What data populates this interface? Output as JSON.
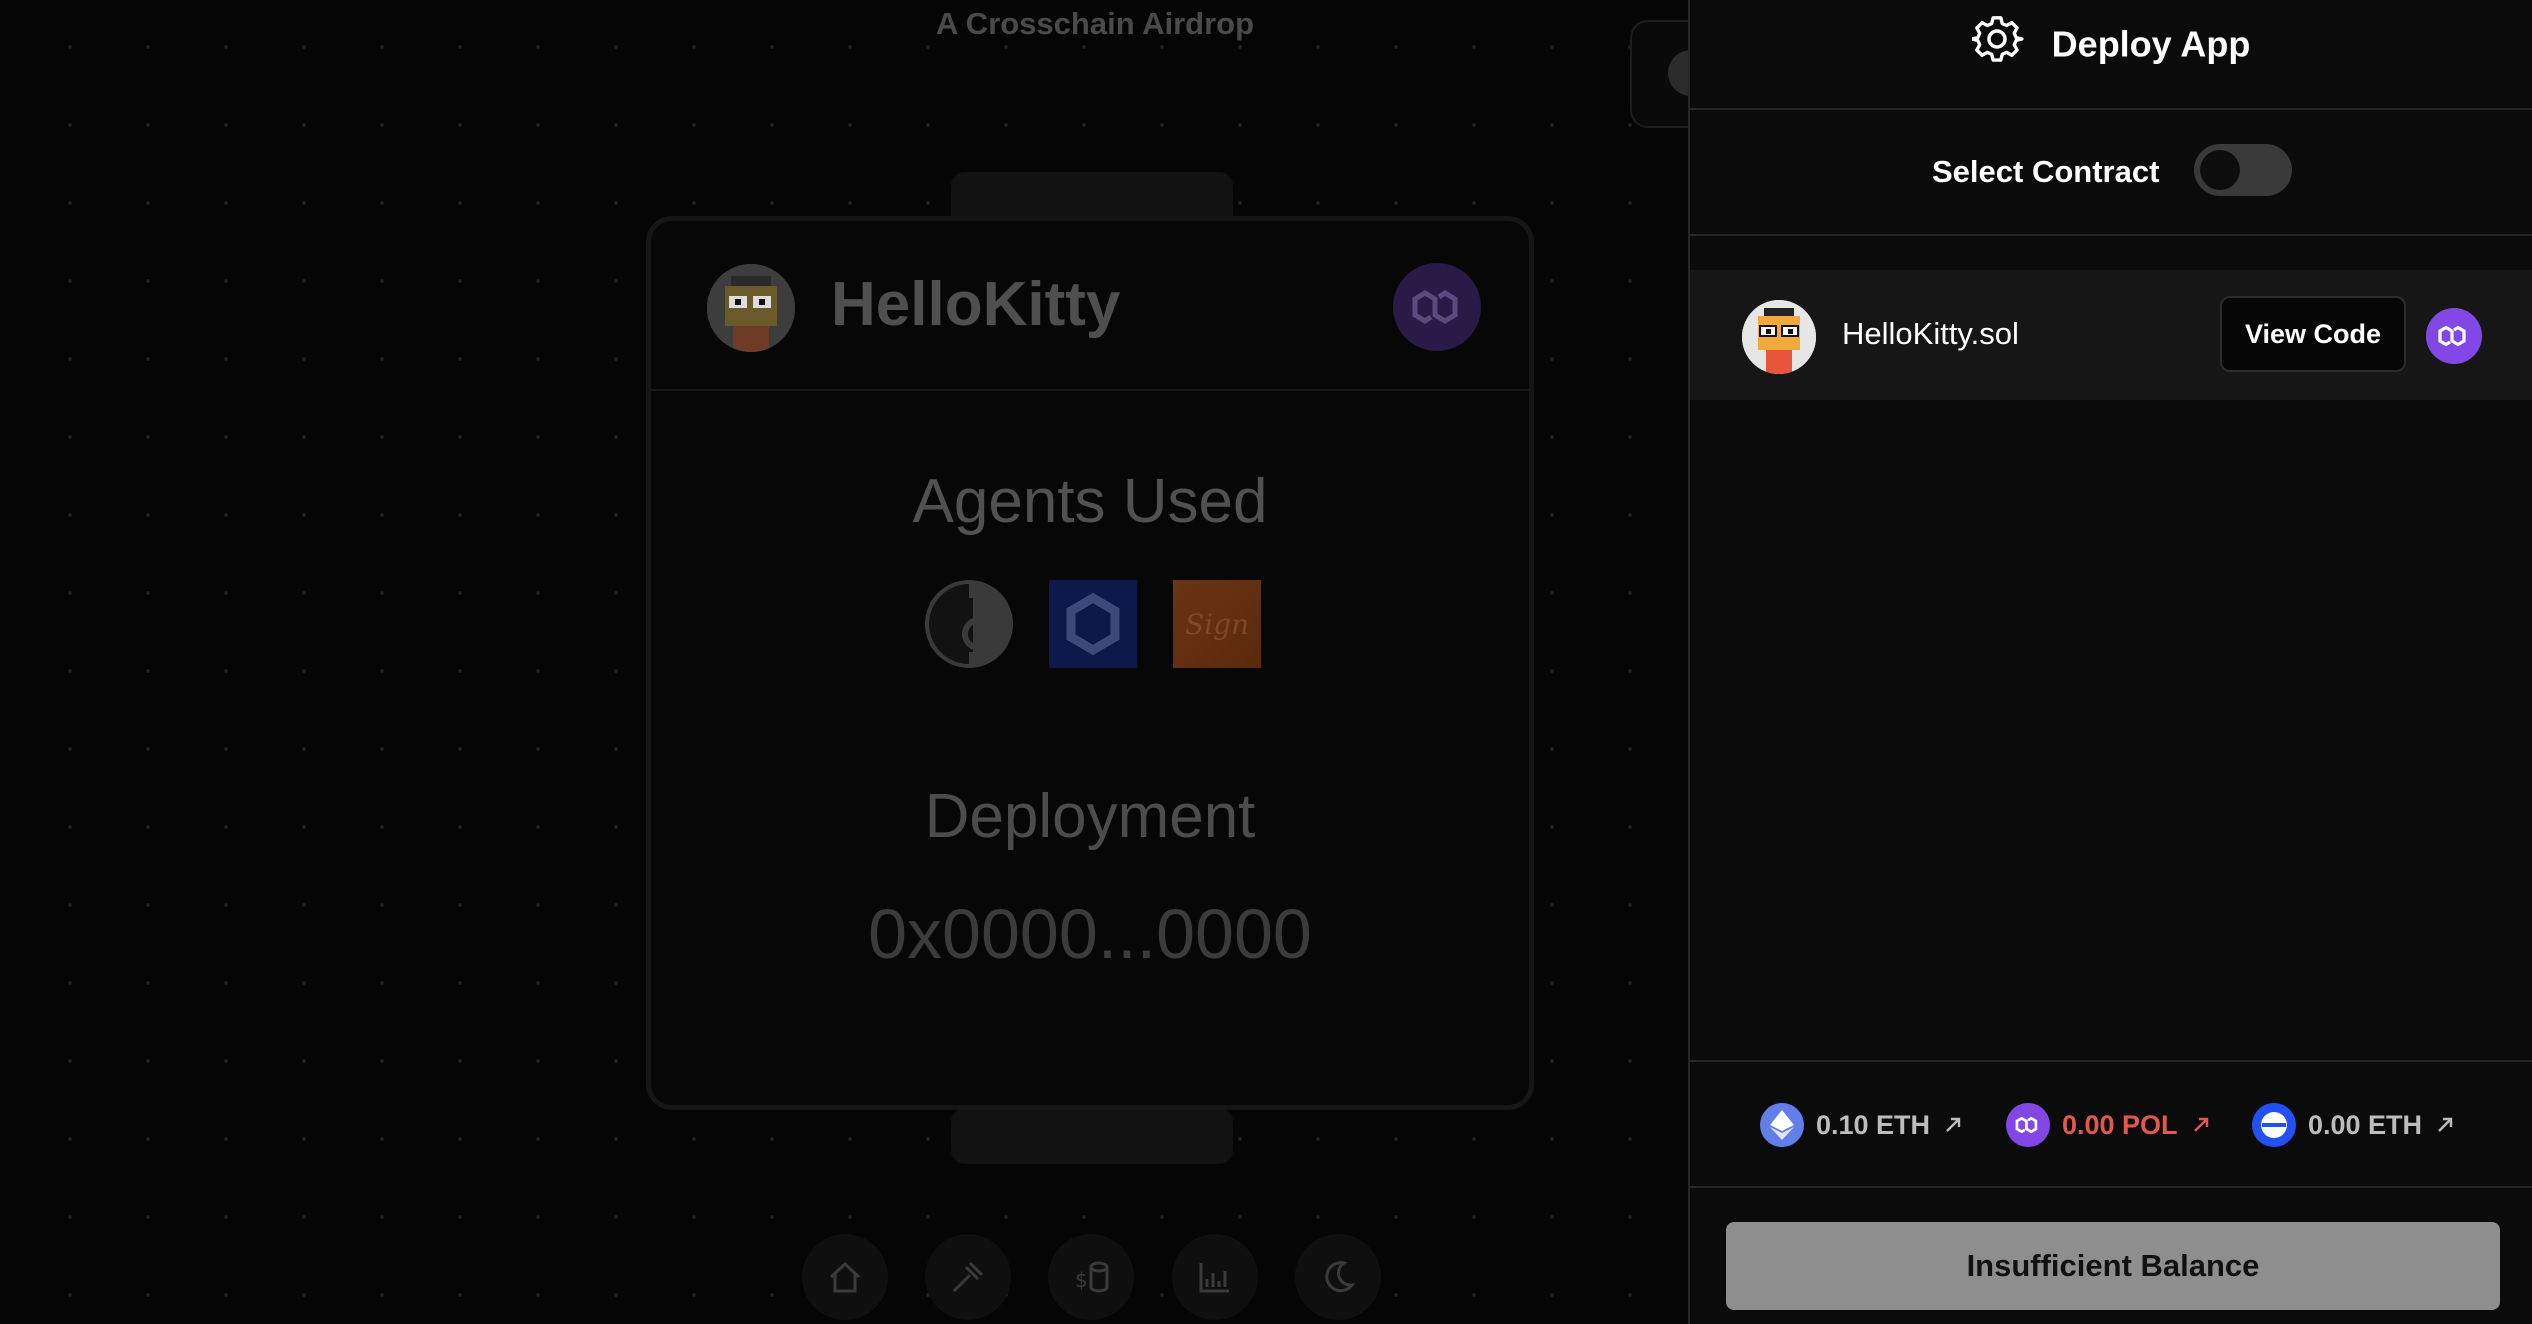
{
  "background": {
    "subtitle": "A Crosschain Airdrop",
    "card": {
      "app_name": "HelloKitty",
      "agents_title": "Agents Used",
      "agents": [
        "agent-one-logo",
        "chainlink-logo",
        "sign-logo"
      ],
      "agent_sign_text": "Sign",
      "deployment_title": "Deployment",
      "deployment_address": "0x0000...0000"
    },
    "nav": [
      "home-icon",
      "hammer-icon",
      "coins-icon",
      "chart-icon",
      "moon-icon"
    ]
  },
  "panel": {
    "title": "Deploy App",
    "select_contract_label": "Select Contract",
    "select_contract_toggle": false,
    "contract": {
      "name": "HelloKitty.sol",
      "view_code_label": "View Code",
      "chain_icon": "polygon-icon"
    },
    "balances": [
      {
        "amount": "0.10 ETH",
        "icon": "ethereum-icon",
        "color": "#627eea"
      },
      {
        "amount": "0.00 POL",
        "icon": "polygon-icon",
        "color": "#8247e5",
        "insufficient": true
      },
      {
        "amount": "0.00 ETH",
        "icon": "base-icon",
        "color": "#2151f5"
      }
    ],
    "action_label": "Insufficient Balance"
  },
  "colors": {
    "accent_purple": "#8247e5",
    "warning_red": "#e2584c"
  }
}
